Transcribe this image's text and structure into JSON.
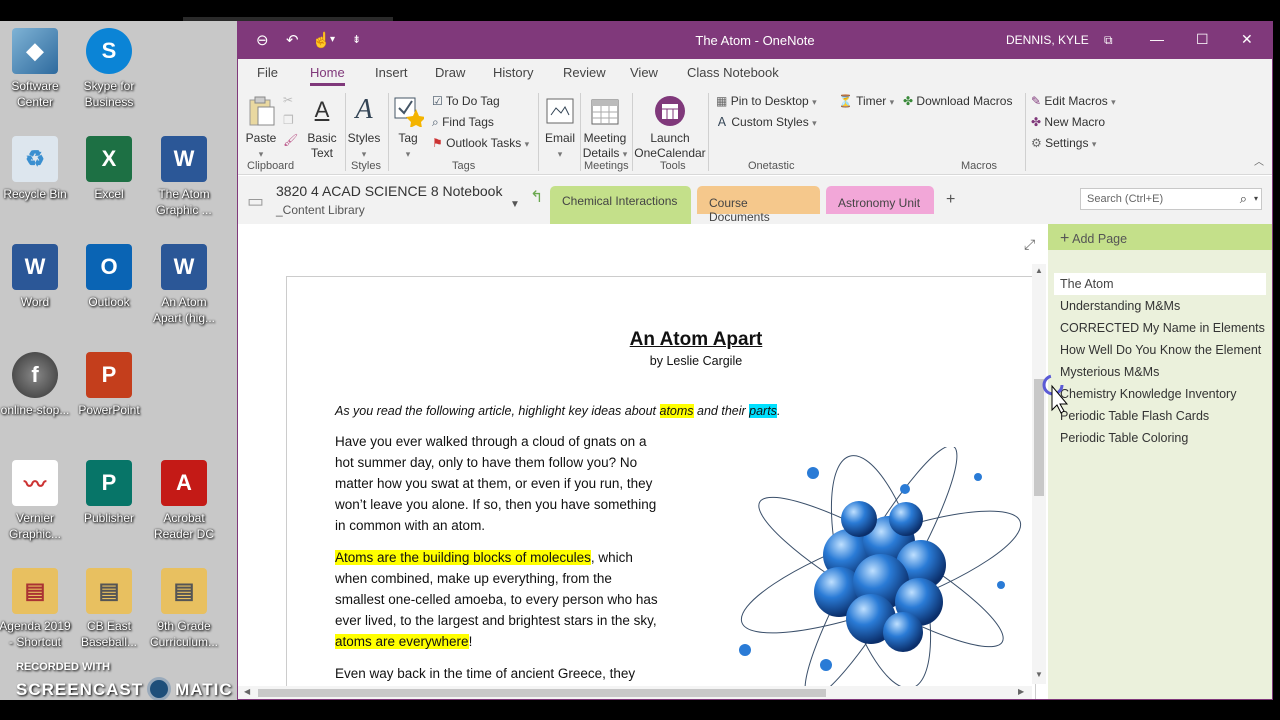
{
  "desktop": {
    "icons": [
      {
        "label": "Software Center"
      },
      {
        "label": "Skype for Business"
      },
      {
        "label": "Recycle Bin"
      },
      {
        "label": "Excel"
      },
      {
        "label": "The Atom Graphic ..."
      },
      {
        "label": "Word"
      },
      {
        "label": "Outlook"
      },
      {
        "label": "An Atom Apart (hig..."
      },
      {
        "label": "online-stop..."
      },
      {
        "label": "PowerPoint"
      },
      {
        "label": "Vernier Graphic..."
      },
      {
        "label": "Publisher"
      },
      {
        "label": "Acrobat Reader DC"
      },
      {
        "label": "Agenda 2019 - Shortcut"
      },
      {
        "label": "CB East Baseball..."
      },
      {
        "label": "9th Grade Curriculum..."
      }
    ],
    "recorder": {
      "recorded_with": "RECORDED WITH",
      "brand_left": "SCREENCAST",
      "brand_right": "MATIC"
    }
  },
  "window": {
    "title": "The Atom  -  OneNote",
    "user": "DENNIS, KYLE",
    "titlebar_color": "#80397B"
  },
  "menu": {
    "tabs": [
      "File",
      "Home",
      "Insert",
      "Draw",
      "History",
      "Review",
      "View",
      "Class Notebook"
    ],
    "active": "Home"
  },
  "ribbon": {
    "paste": "Paste",
    "basic_text": "Basic Text",
    "styles": "Styles",
    "tag": "Tag",
    "todo_tag": "To Do Tag",
    "find_tags": "Find Tags",
    "outlook_tasks": "Outlook Tasks",
    "email": "Email",
    "meeting_details": "Meeting Details",
    "launch": "Launch",
    "onecalendar": "OneCalendar",
    "pin_to_desktop": "Pin to Desktop",
    "custom_styles": "Custom Styles",
    "timer": "Timer",
    "download_macros": "Download Macros",
    "edit_macros": "Edit Macros",
    "new_macro": "New Macro",
    "settings": "Settings",
    "groups": {
      "clipboard": "Clipboard",
      "styles": "Styles",
      "tags": "Tags",
      "meetings": "Meetings",
      "tools": "Tools",
      "onetastic": "Onetastic",
      "macros": "Macros"
    }
  },
  "notebook": {
    "name": "3820 4 ACAD SCIENCE 8 Notebook",
    "section_group": "_Content Library",
    "sections": [
      "Chemical Interactions",
      "Course Documents",
      "Astronomy Unit"
    ],
    "add_section": "+",
    "search_placeholder": "Search (Ctrl+E)"
  },
  "document": {
    "title": "An Atom Apart",
    "byline": "by Leslie Cargile",
    "instruction_a": "As you read the following article, highlight key ideas about ",
    "instruction_atoms": "atoms",
    "instruction_b": " and their ",
    "instruction_parts": "parts",
    "instruction_c": ".",
    "p1_l1": "Have you ever walked through a cloud of gnats on a",
    "p1_l2": "hot summer day, only to have them follow you?  No",
    "p1_l3": "matter how you swat at them, or even if you run, they",
    "p1_l4": "won’t leave you alone. If so, then you have something",
    "p1_l5": "in common with an atom.",
    "p2_hl": "Atoms are the building blocks of molecules",
    "p2_l1_rest": ", which",
    "p2_l2": "when combined, make up everything, from the",
    "p2_l3": "smallest one-celled amoeba, to every person who has",
    "p2_l4": "ever lived, to the largest and brightest stars in the sky,",
    "p2_hl2": "atoms are everywhere",
    "p2_end": "!",
    "p3_l1": "Even way back in the time of ancient Greece, they"
  },
  "pages": {
    "add_page": "Add Page",
    "items": [
      "The Atom",
      "Understanding M&Ms",
      "CORRECTED My Name in Elements",
      "How Well Do You Know the Element",
      "Mysterious M&Ms",
      "Chemistry Knowledge Inventory",
      "Periodic Table Flash Cards",
      "Periodic Table Coloring"
    ],
    "selected": 0
  }
}
